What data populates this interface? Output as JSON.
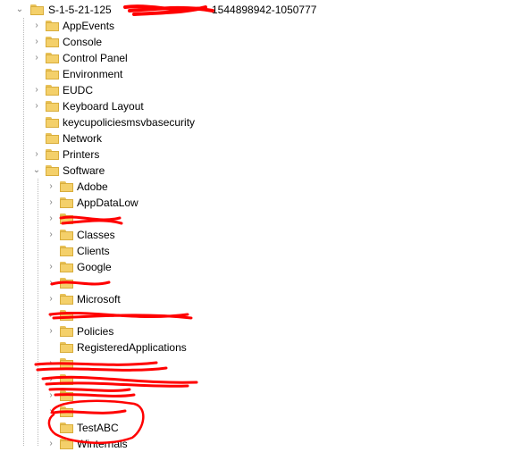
{
  "root": {
    "label": "S-1-5-21-125",
    "label_suffix": "1544898942-1050777",
    "icon": "folder-open-icon"
  },
  "level1": [
    {
      "label": "AppEvents"
    },
    {
      "label": "Console"
    },
    {
      "label": "Control Panel"
    },
    {
      "label": "Environment"
    },
    {
      "label": "EUDC"
    },
    {
      "label": "Keyboard Layout"
    },
    {
      "label": "keycupoliciesmsvbasecurity"
    },
    {
      "label": "Network"
    },
    {
      "label": "Printers"
    },
    {
      "label": "Software"
    }
  ],
  "software_children": [
    {
      "label": "Adobe"
    },
    {
      "label": "AppDataLow"
    },
    {
      "label": "Classes"
    },
    {
      "label": "Clients"
    },
    {
      "label": "Google"
    },
    {
      "label": "Microsoft"
    },
    {
      "label": "Policies"
    },
    {
      "label": "RegisteredApplications"
    },
    {
      "label": "TestABC"
    },
    {
      "label": "Winternals"
    }
  ],
  "colors": {
    "folder": "#f4d06a",
    "folder_border": "#d8ad3c",
    "redaction": "#ff0000",
    "chevron": "#7a7a7a"
  }
}
